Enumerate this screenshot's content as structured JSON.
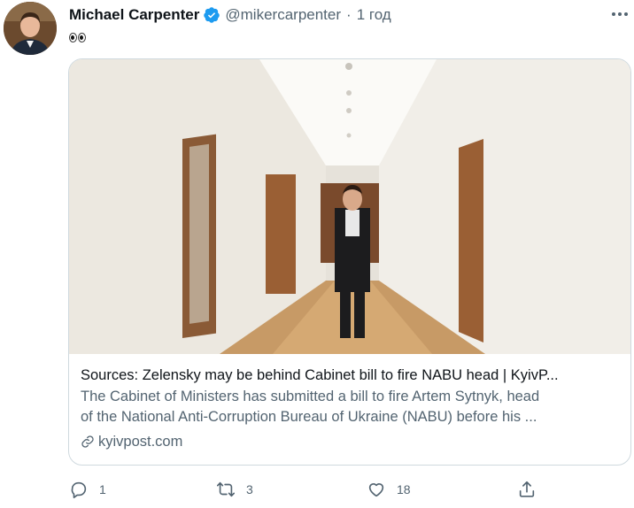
{
  "tweet": {
    "author_name": "Michael Carpenter",
    "handle": "@mikercarpenter",
    "separator": "·",
    "time": "1 год",
    "text_emoji": "eyes"
  },
  "card": {
    "title": "Sources: Zelensky may be behind Cabinet bill to fire NABU head | KyivP...",
    "description_line1": "The Cabinet of Ministers has submitted a bill to fire Artem Sytnyk, head",
    "description_line2": "of the National Anti-Corruption Bureau of Ukraine (NABU) before his ...",
    "domain": "kyivpost.com"
  },
  "actions": {
    "replies": "1",
    "retweets": "3",
    "likes": "18"
  },
  "colors": {
    "text_primary": "#0f1419",
    "text_secondary": "#536471",
    "verified_blue": "#1d9bf0",
    "border": "#cfd9de"
  }
}
